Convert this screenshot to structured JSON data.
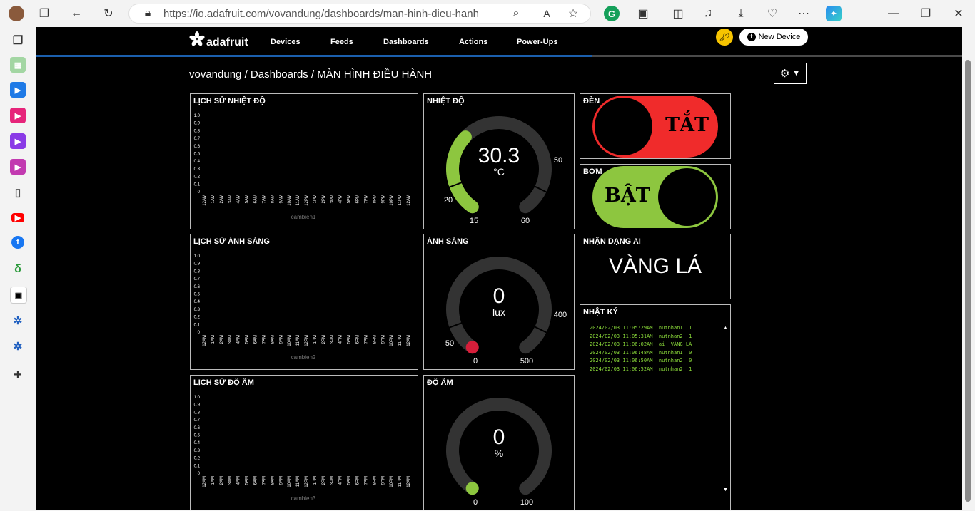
{
  "browser": {
    "url": "https://io.adafruit.com/vovandung/dashboards/man-hinh-dieu-hanh",
    "reader_label": "A",
    "sidebar_icons": [
      "tabs-icon",
      "sheets-icon",
      "play-icon",
      "play-icon",
      "play-icon",
      "play-icon",
      "page-icon",
      "youtube-icon",
      "facebook-icon",
      "app-icon",
      "image-icon",
      "network-icon",
      "network-icon",
      "add-icon"
    ]
  },
  "nav": {
    "logo_text": "adafruit",
    "items": [
      "Devices",
      "Feeds",
      "Dashboards",
      "Actions",
      "Power-Ups"
    ],
    "new_device": "New Device"
  },
  "breadcrumb": "vovandung / Dashboards / MÀN HÌNH ĐIỀU HÀNH",
  "charts": {
    "temp_history": {
      "title": "LỊCH SỬ NHIỆT ĐỘ",
      "series": "cambien1"
    },
    "light_history": {
      "title": "LỊCH SỬ ÁNH SÁNG",
      "series": "cambien2"
    },
    "humid_history": {
      "title": "LỊCH SỬ ĐỘ ẨM",
      "series": "cambien3"
    }
  },
  "chart_data": [
    {
      "type": "line",
      "title": "LỊCH SỬ NHIỆT ĐỘ",
      "x": [
        "12AM",
        "1AM",
        "2AM",
        "3AM",
        "4AM",
        "5AM",
        "6AM",
        "7AM",
        "8AM",
        "9AM",
        "10AM",
        "11AM",
        "12PM",
        "1PM",
        "2PM",
        "3PM",
        "4PM",
        "5PM",
        "6PM",
        "7PM",
        "8PM",
        "9PM",
        "10PM",
        "11PM",
        "12AM"
      ],
      "yticks": [
        "0",
        "0.1",
        "0.2",
        "0.3",
        "0.4",
        "0.5",
        "0.6",
        "0.7",
        "0.8",
        "0.9",
        "1.0"
      ],
      "ylim": [
        0,
        1
      ],
      "series": [
        {
          "name": "cambien1",
          "values": []
        }
      ]
    },
    {
      "type": "line",
      "title": "LỊCH SỬ ÁNH SÁNG",
      "x": [
        "12AM",
        "1AM",
        "2AM",
        "3AM",
        "4AM",
        "5AM",
        "6AM",
        "7AM",
        "8AM",
        "9AM",
        "10AM",
        "11AM",
        "12PM",
        "1PM",
        "2PM",
        "3PM",
        "4PM",
        "5PM",
        "6PM",
        "7PM",
        "8PM",
        "9PM",
        "10PM",
        "11PM",
        "12AM"
      ],
      "yticks": [
        "0",
        "0.1",
        "0.2",
        "0.3",
        "0.4",
        "0.5",
        "0.6",
        "0.7",
        "0.8",
        "0.9",
        "1.0"
      ],
      "ylim": [
        0,
        1
      ],
      "series": [
        {
          "name": "cambien2",
          "values": []
        }
      ]
    },
    {
      "type": "line",
      "title": "LỊCH SỬ ĐỘ ẨM",
      "x": [
        "12AM",
        "1AM",
        "2AM",
        "3AM",
        "4AM",
        "5AM",
        "6AM",
        "7AM",
        "8AM",
        "9AM",
        "10AM",
        "11AM",
        "12PM",
        "1PM",
        "2PM",
        "3PM",
        "4PM",
        "5PM",
        "6PM",
        "7PM",
        "8PM",
        "9PM",
        "10PM",
        "11PM",
        "12AM"
      ],
      "yticks": [
        "0",
        "0.1",
        "0.2",
        "0.3",
        "0.4",
        "0.5",
        "0.6",
        "0.7",
        "0.8",
        "0.9",
        "1.0"
      ],
      "ylim": [
        0,
        1
      ],
      "series": [
        {
          "name": "cambien3",
          "values": []
        }
      ]
    }
  ],
  "gauges": {
    "temp": {
      "title": "NHIỆT ĐỘ",
      "value": "30.3",
      "unit": "°C",
      "min": "15",
      "max": "60",
      "low": "20",
      "high": "50",
      "fraction": 0.34,
      "color": "#8dc63f"
    },
    "light": {
      "title": "ÁNH SÁNG",
      "value": "0",
      "unit": "lux",
      "min": "0",
      "max": "500",
      "low": "50",
      "high": "400",
      "fraction": 0.0,
      "color": "#d61e3a"
    },
    "humid": {
      "title": "ĐỘ ẨM",
      "value": "0",
      "unit": "%",
      "min": "0",
      "max": "100",
      "fraction": 0.0,
      "color": "#8dc63f"
    }
  },
  "toggles": {
    "den": {
      "title": "ĐÈN",
      "label": "TẮT",
      "color": "#f02b2b"
    },
    "bom": {
      "title": "BƠM",
      "label": "BẬT",
      "color": "#8dc63f"
    }
  },
  "ai": {
    "title": "NHẬN DẠNG AI",
    "value": "VÀNG LÁ"
  },
  "log": {
    "title": "NHẬT KÝ",
    "lines": [
      "2024/02/03 11:05:29AM  nutnhan1  1",
      "2024/02/03 11:05:31AM  nutnhan2  1",
      "2024/02/03 11:06:02AM  ai  VÀNG LÁ",
      "2024/02/03 11:06:48AM  nutnhan1  0",
      "2024/02/03 11:06:50AM  nutnhan2  0",
      "2024/02/03 11:06:52AM  nutnhan2  1"
    ]
  }
}
